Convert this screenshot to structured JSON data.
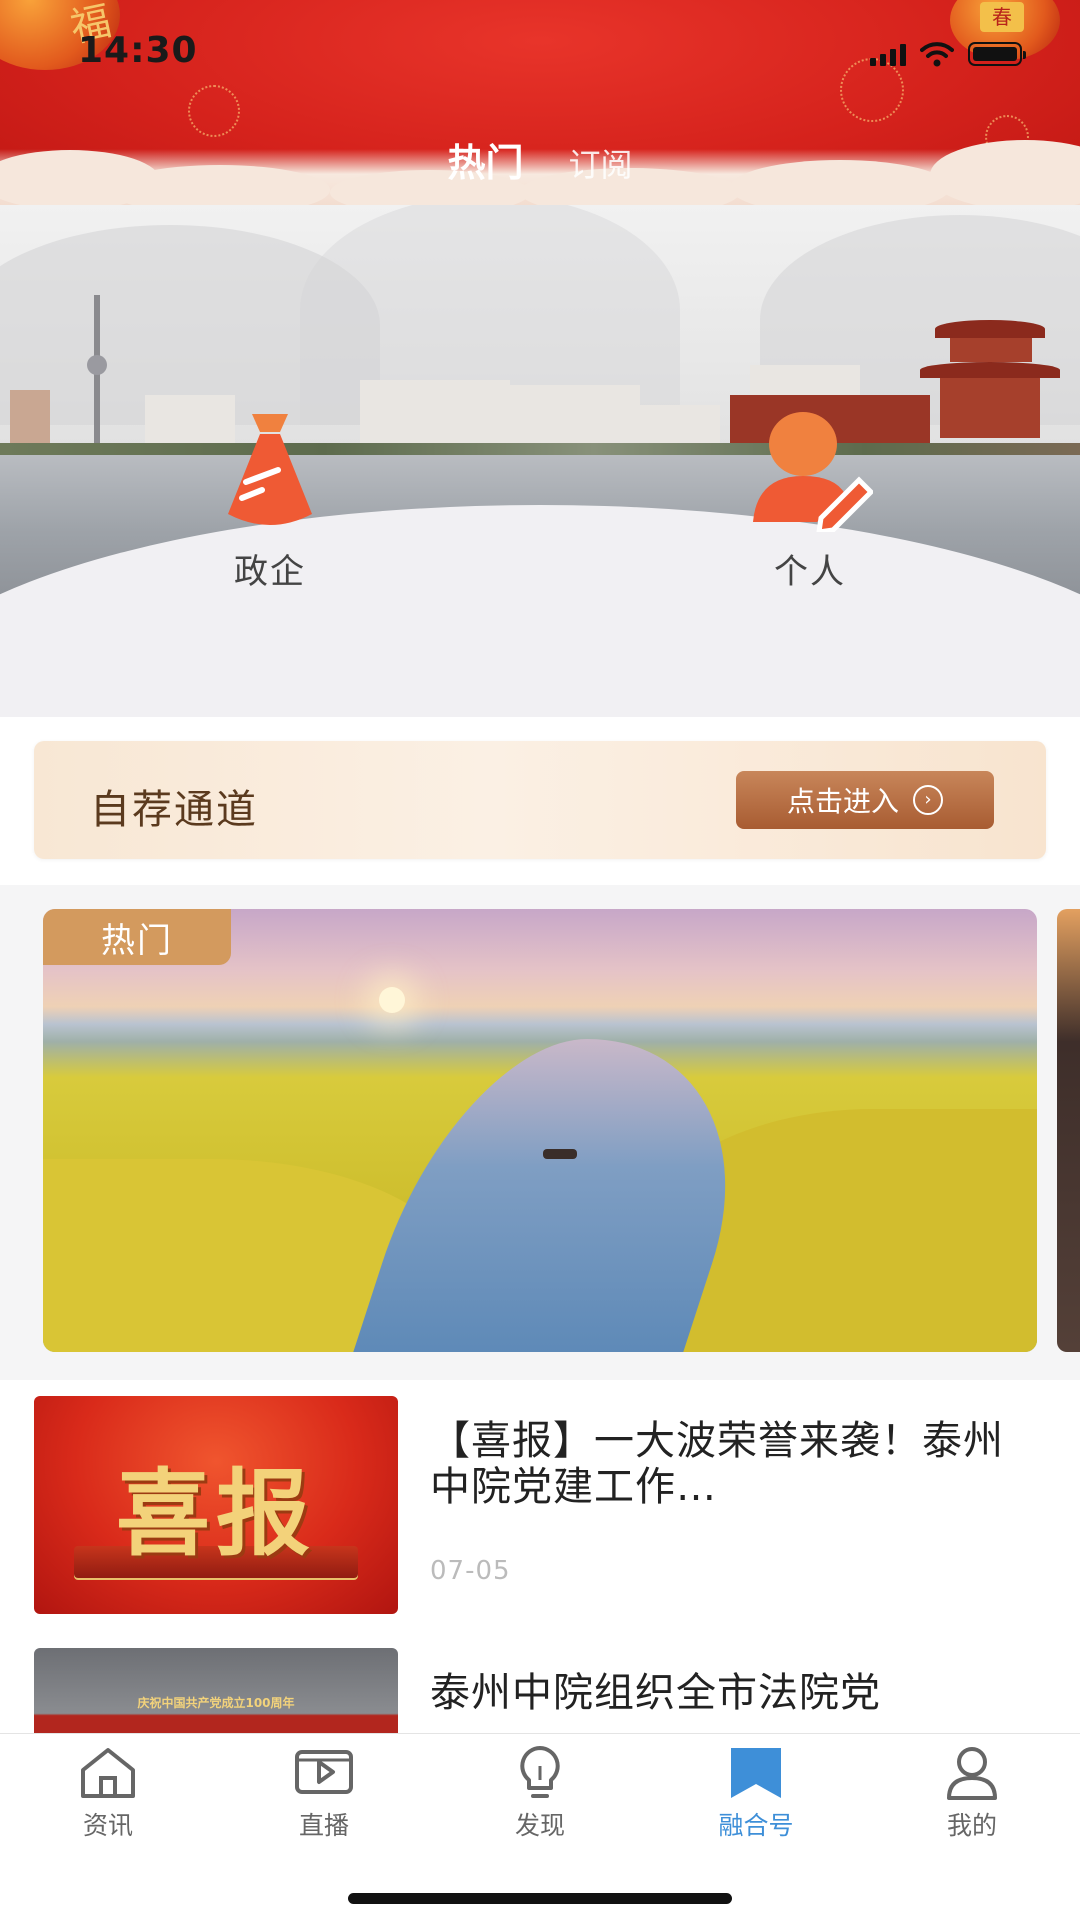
{
  "status_bar": {
    "time": "14:30"
  },
  "header": {
    "tabs": [
      {
        "label": "热门",
        "active": true
      },
      {
        "label": "订阅",
        "active": false
      }
    ],
    "decoration_text": "福",
    "spring_badge": "春"
  },
  "categories": [
    {
      "label": "政企",
      "icon": "tie-icon"
    },
    {
      "label": "个人",
      "icon": "person-edit-icon"
    }
  ],
  "recommend": {
    "title": "自荐通道",
    "button_label": "点击进入"
  },
  "hot": {
    "badge": "热门"
  },
  "news": [
    {
      "title": "【喜报】一大波荣誉来袭！泰州中院党建工作…",
      "date": "07-05",
      "thumb_text": "喜报"
    },
    {
      "title": "泰州中院组织全市法院党",
      "date": "",
      "thumb_text": "庆祝中国共产党成立100周年"
    }
  ],
  "bottom_nav": [
    {
      "label": "资讯",
      "icon": "home-icon",
      "active": false
    },
    {
      "label": "直播",
      "icon": "live-icon",
      "active": false
    },
    {
      "label": "发现",
      "icon": "bulb-icon",
      "active": false
    },
    {
      "label": "融合号",
      "icon": "bookmark-icon",
      "active": true
    },
    {
      "label": "我的",
      "icon": "user-icon",
      "active": false
    }
  ],
  "colors": {
    "header_red": "#d5221c",
    "accent_blue": "#3e8fd8",
    "button_brown": "#a85c32",
    "badge_gold": "#d39a5e"
  }
}
